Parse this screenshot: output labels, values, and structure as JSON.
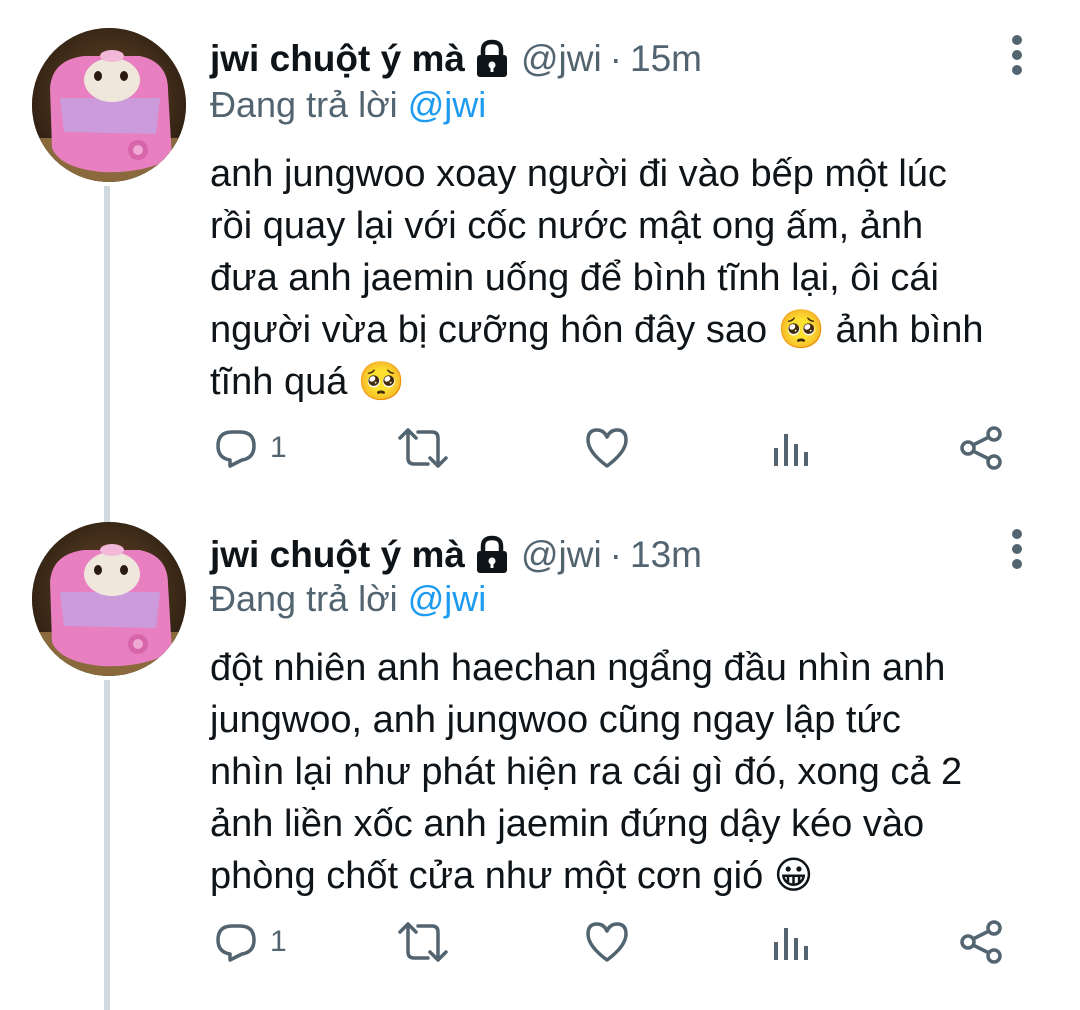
{
  "tweets": [
    {
      "display_name": "jwi chuột ý mà",
      "handle": "@jwi",
      "separator": "·",
      "time": "15m",
      "reply_prefix": "Đang trả lời",
      "reply_handle": "@jwi",
      "text": "anh jungwoo xoay người đi vào bếp một lúc\nrồi quay lại với cốc nước mật ong ấm, ảnh\nđưa anh jaemin uống để bình tĩnh lại, ôi cái\nngười vừa bị cưỡng hôn đây sao 🥺 ảnh bình\ntĩnh quá 🥺",
      "reply_count": "1"
    },
    {
      "display_name": "jwi chuột ý mà",
      "handle": "@jwi",
      "separator": "·",
      "time": "13m",
      "reply_prefix": "Đang trả lời",
      "reply_handle": "@jwi",
      "text": "đột nhiên anh haechan ngẩng đầu nhìn anh\njungwoo, anh jungwoo cũng ngay lập tức\nnhìn lại như phát hiện ra cái gì đó, xong cả 2\nảnh liền xốc anh jaemin đứng dậy kéo vào\nphòng chốt cửa như một cơn gió 😀",
      "reply_count": "1"
    }
  ],
  "icons": {
    "lock": "lock-icon",
    "more": "more-vertical-icon",
    "reply": "reply-icon",
    "retweet": "retweet-icon",
    "like": "heart-icon",
    "views": "views-icon",
    "share": "share-icon"
  },
  "colors": {
    "link": "#1d9bf0",
    "secondary_text": "#536471",
    "thread_line": "#cfd9de",
    "avatar_car_pink": "#e87fc0"
  }
}
